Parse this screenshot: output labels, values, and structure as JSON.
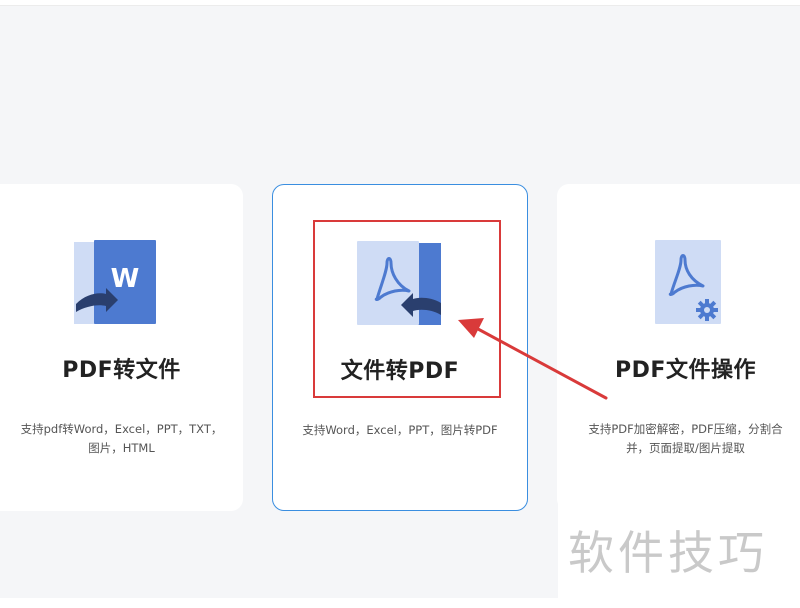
{
  "cards": [
    {
      "title": "PDF转文件",
      "desc_line1": "支持pdf转Word，Excel，PPT，TXT，",
      "desc_line2": "图片，HTML",
      "icon": "pdf-to-word-icon"
    },
    {
      "title": "文件转PDF",
      "desc_line1": "支持Word，Excel，PPT，图片转PDF",
      "desc_line2": "",
      "icon": "file-to-pdf-icon",
      "selected": true
    },
    {
      "title": "PDF文件操作",
      "desc_line1": "支持PDF加密解密，PDF压缩，分割合",
      "desc_line2": "并，页面提取/图片提取",
      "icon": "pdf-settings-icon"
    }
  ],
  "watermark": "软件技巧",
  "colors": {
    "icon_light": "#cfdcf5",
    "icon_dark": "#4d7ad0",
    "selected_border": "#3a8ee0",
    "annotation_red": "#d93a3a",
    "page_bg": "#f5f6f8"
  }
}
